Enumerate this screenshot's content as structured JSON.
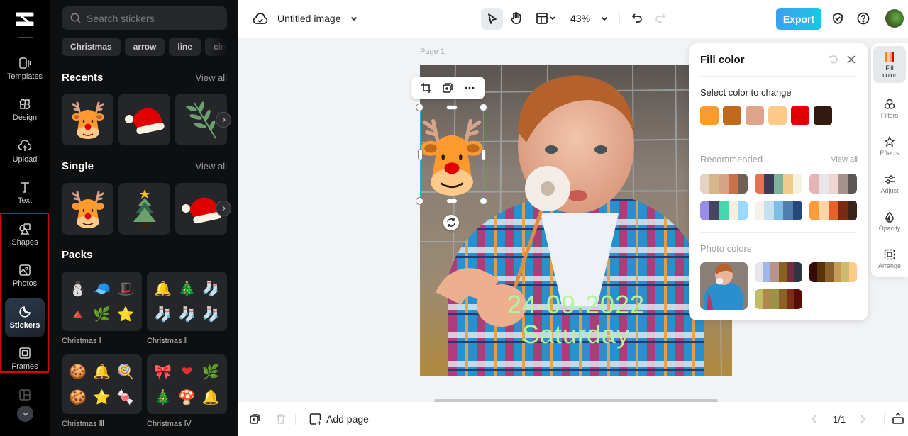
{
  "app": {
    "name": "CapCut"
  },
  "rail": {
    "items": [
      {
        "id": "templates",
        "label": "Templates",
        "icon": "templates-icon"
      },
      {
        "id": "design",
        "label": "Design",
        "icon": "design-icon"
      },
      {
        "id": "upload",
        "label": "Upload",
        "icon": "upload-icon"
      },
      {
        "id": "text",
        "label": "Text",
        "icon": "text-icon"
      },
      {
        "id": "shapes",
        "label": "Shapes",
        "icon": "shapes-icon"
      },
      {
        "id": "photos",
        "label": "Photos",
        "icon": "photos-icon"
      },
      {
        "id": "stickers",
        "label": "Stickers",
        "icon": "stickers-icon",
        "active": true
      },
      {
        "id": "frames",
        "label": "Frames",
        "icon": "frames-icon"
      },
      {
        "id": "collage",
        "label": "Collage",
        "icon": "collage-icon"
      }
    ],
    "highlight_color": "#e00000"
  },
  "stickers_panel": {
    "search_placeholder": "Search stickers",
    "chips": [
      "Christmas",
      "arrow",
      "line",
      "circle"
    ],
    "recents": {
      "title": "Recents",
      "view_all": "View all",
      "items": [
        "reindeer",
        "santa-hat",
        "green-branch"
      ]
    },
    "single": {
      "title": "Single",
      "view_all": "View all",
      "items": [
        "reindeer",
        "christmas-tree",
        "santa-hat"
      ]
    },
    "packs": {
      "title": "Packs",
      "items": [
        {
          "label": "Christmas Ⅰ",
          "emojis": [
            "⛄",
            "🧢",
            "🎩",
            "🔺",
            "🌿",
            "⭐"
          ]
        },
        {
          "label": "Christmas Ⅱ",
          "emojis": [
            "🔔",
            "🎄",
            "🧦",
            "🧦",
            "🧦",
            "🧦"
          ]
        },
        {
          "label": "Christmas Ⅲ",
          "emojis": [
            "🍪",
            "🔔",
            "🍭",
            "🍪",
            "⭐",
            "🍬"
          ]
        },
        {
          "label": "Christmas Ⅳ",
          "emojis": [
            "🎀",
            "❤",
            "🌿",
            "🎄",
            "🍄",
            "🔔"
          ]
        }
      ]
    }
  },
  "topbar": {
    "title": "Untitled image",
    "zoom": "43%",
    "export_label": "Export"
  },
  "canvas": {
    "page_label": "Page 1",
    "text_line1": "24-09-2022",
    "text_line2": "Saturday",
    "text_color": "#b4f3a0",
    "selection_color": "#19b6d2"
  },
  "fill_panel": {
    "title": "Fill color",
    "select_label": "Select color to change",
    "swatches": [
      "#FF9A2E",
      "#BF6A1C",
      "#DDA48A",
      "#FFCA8A",
      "#E00000",
      "#321A10"
    ],
    "recommended_label": "Recommended",
    "view_all": "View all",
    "recommended": [
      [
        "#E4D3C3",
        "#D8B68E",
        "#D9A38A",
        "#C8714A",
        "#6E6158"
      ],
      [
        "#DF7257",
        "#3A3B58",
        "#7DB59A",
        "#F2CA8A",
        "#F4F1E0"
      ],
      [
        "#E6B3B6",
        "#E8E6EA",
        "#EFD5D2",
        "#A4918E",
        "#5E5556"
      ],
      [
        "#9A8CE9",
        "#464562",
        "#42D9AE",
        "#F3F1DE",
        "#99D8FF"
      ],
      [
        "#F6F2EA",
        "#C6E0EF",
        "#7EBDE4",
        "#4E7FAF",
        "#234A78"
      ],
      [
        "#FF9E38",
        "#FFD4A6",
        "#E6622A",
        "#7A2A10",
        "#3C251A"
      ]
    ],
    "photo_colors_label": "Photo colors",
    "photo_palettes": [
      [
        "#E6E4EC",
        "#A3B7E6",
        "#B79388",
        "#8A6021",
        "#70303A",
        "#2D3644"
      ],
      [
        "#350B0A",
        "#573308",
        "#89612A",
        "#C79A58",
        "#CDBB6E",
        "#FECA85"
      ],
      [
        "#C2BD68",
        "#B1874A",
        "#9B9246",
        "#8A6225",
        "#7C2E16",
        "#5A0C04"
      ]
    ]
  },
  "right_rail": {
    "items": [
      {
        "label": "Fill color",
        "active": true
      },
      {
        "label": "Filters"
      },
      {
        "label": "Effects"
      },
      {
        "label": "Adjust"
      },
      {
        "label": "Opacity"
      },
      {
        "label": "Arrange"
      }
    ]
  },
  "bottombar": {
    "add_page": "Add page",
    "page_indicator": "1/1"
  }
}
